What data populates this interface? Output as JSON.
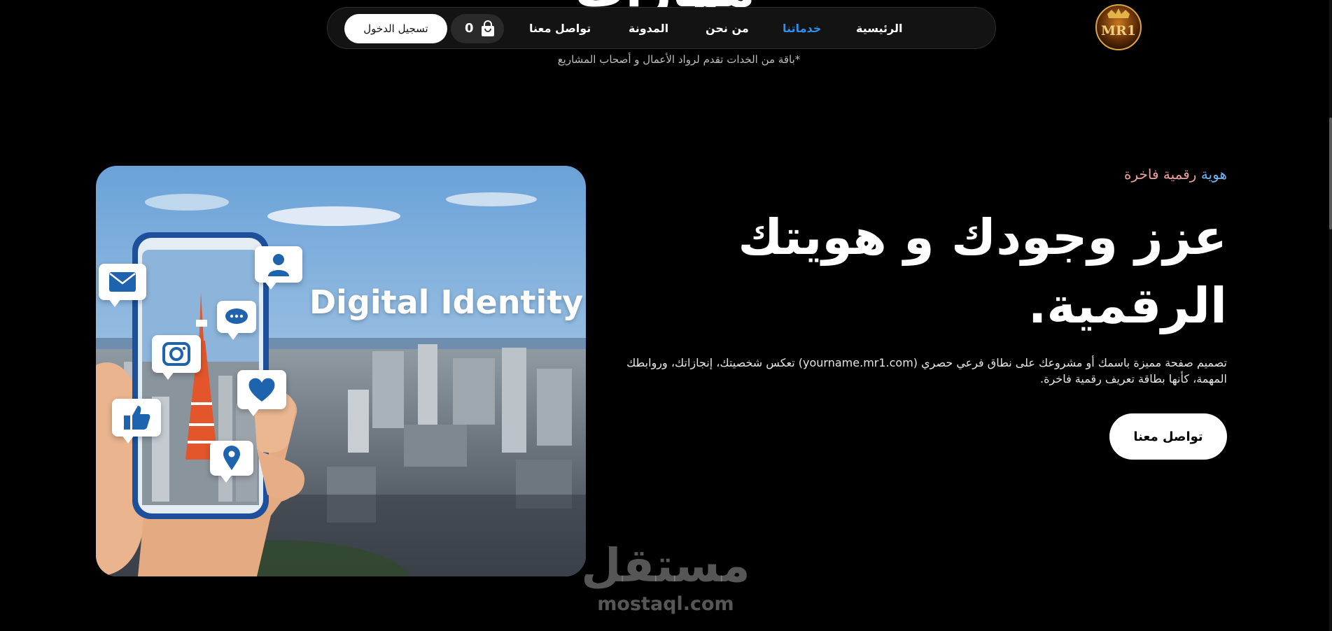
{
  "hero_cut_heading": "مهارات",
  "nav": {
    "links": [
      "الرئيسية",
      "خدماتنا",
      "من نحن",
      "المدونة",
      "تواصل معنا"
    ],
    "active_index": 1,
    "cart_count": "0",
    "login_label": "تسجيل الدخول"
  },
  "logo": {
    "text": "MR1"
  },
  "tagline": "*باقة من الخدات تقدم لرواد الأعمال و أصحاب المشاريع",
  "hero": {
    "image_title": "Digital Identity",
    "eyebrow_accent": "هوية",
    "eyebrow_rest": "رقمية فاخرة",
    "headline_line1": "عزز وجودك و هويتك",
    "headline_line2": "الرقمية.",
    "description": "تصميم صفحة مميزة باسمك أو مشروعك على نطاق فرعي حصري (yourname.mr1.com) تعكس شخصيتك، إنجازاتك، وروابطك المهمة، كأنها بطاقة تعريف رقمية فاخرة.",
    "cta_label": "تواصل معنا"
  },
  "watermark": {
    "arabic": "مستقل",
    "latin": "mostaql.com"
  },
  "colors": {
    "background": "#000000",
    "accent": "#2f8ff0",
    "eyebrow_accent": "#6fb4ee",
    "eyebrow_rest": "#e8a0a0"
  }
}
